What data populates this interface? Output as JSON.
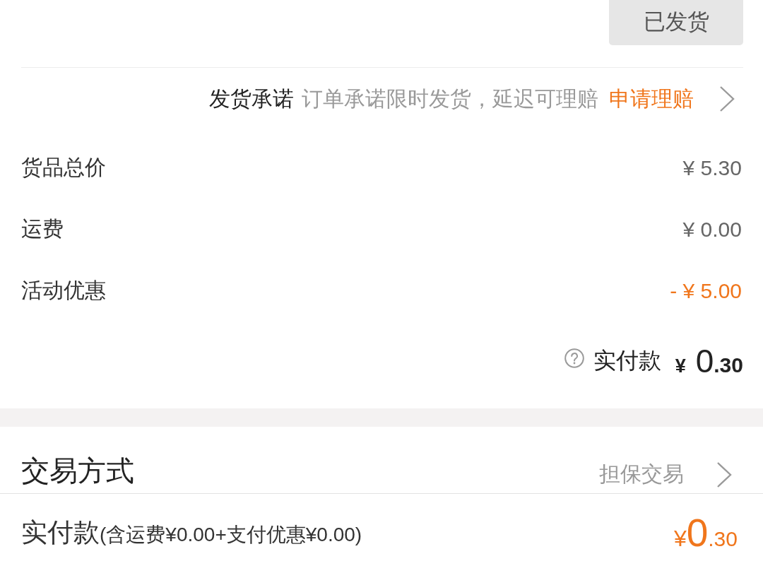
{
  "order_status_button": {
    "label": "已发货"
  },
  "delivery_promise": {
    "label": "发货承诺",
    "description": "订单承诺限时发货，延迟可理赔",
    "link": "申请理赔"
  },
  "price_rows": [
    {
      "label": "货品总价",
      "value": "¥ 5.30",
      "kind": "normal"
    },
    {
      "label": "运费",
      "value": "¥ 0.00",
      "kind": "normal"
    },
    {
      "label": "活动优惠",
      "value": "- ¥ 5.00",
      "kind": "discount"
    }
  ],
  "total": {
    "label": "实付款",
    "currency": "¥",
    "integer": "0",
    "decimal": ".30"
  },
  "trade_method": {
    "label": "交易方式",
    "value": "担保交易"
  },
  "footer": {
    "label": "实付款",
    "note": "(含运费¥0.00+支付优惠¥0.00)",
    "currency": "¥",
    "integer": "0",
    "decimal": ".30"
  }
}
